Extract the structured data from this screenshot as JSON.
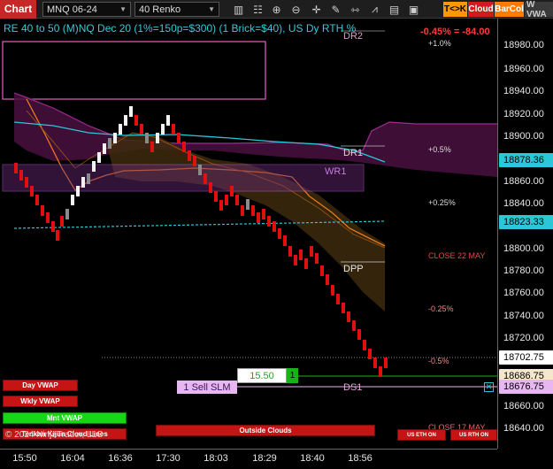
{
  "toolbar": {
    "chart_tab": "Chart",
    "instrument": "MNQ 06-24",
    "bar_type": "40 Renko",
    "buttons": {
      "tk": "T<>K",
      "cloud": "Cloud",
      "barcol": "BarCol",
      "vwa": "W VWA"
    },
    "icons": [
      "bar-type-icon",
      "properties-icon",
      "zoom-in-icon",
      "zoom-out-icon",
      "crosshair-icon",
      "pencil-icon",
      "measure-icon",
      "indicators-icon",
      "strategy-icon",
      "data-box-icon"
    ]
  },
  "chart": {
    "title": "RE 40 to 50 (M)NQ Dec 20 (1%=150p=$300) (1 Brick=$40), US Dy RTH %",
    "pnl": "-0.45% = -84.00",
    "level_labels": [
      "DR2",
      "DR1",
      "WR1",
      "DPP",
      "DS1"
    ],
    "pct_labels": [
      "+1.0%",
      "+0.5%",
      "+0.25%",
      "CLOSE 22 MAY",
      "-0.25%",
      "-0.5%",
      "CLOSE 17 MAY"
    ],
    "copyright": "© 2024 NinjaTrader, LLC"
  },
  "price_axis": {
    "ticks": [
      "18980.00",
      "18960.00",
      "18940.00",
      "18920.00",
      "18900.00",
      "18860.00",
      "18840.00",
      "18800.00",
      "18780.00",
      "18760.00",
      "18740.00",
      "18720.00",
      "18660.00",
      "18640.00"
    ],
    "badges": {
      "ema": "18878.36",
      "vwap": "18823.33",
      "last": "18702.75",
      "order": "18686.75",
      "stop": "18676.75"
    }
  },
  "time_axis": {
    "ticks": [
      "15:50",
      "16:04",
      "16:36",
      "17:30",
      "18:03",
      "18:29",
      "18:40",
      "18:56"
    ]
  },
  "overlays": {
    "day_vwap": "Day VWAP",
    "wkly_vwap": "Wkly VWAP",
    "mnt_vwap": "Mnt VWAP",
    "tenkan": "Tenkan Kijun Cloud Lines",
    "outside_clouds": "Outside Clouds",
    "us_eth_on": "US ETH ON",
    "us_rth_on": "US RTH ON",
    "order_label": "1 Sell SLM",
    "order_qty": "15.50",
    "order_count": "1"
  },
  "colors": {
    "up": "#f2f2f2",
    "down": "#e01010",
    "accent": "#29c7d7",
    "cloud": "#6a1f5a"
  }
}
